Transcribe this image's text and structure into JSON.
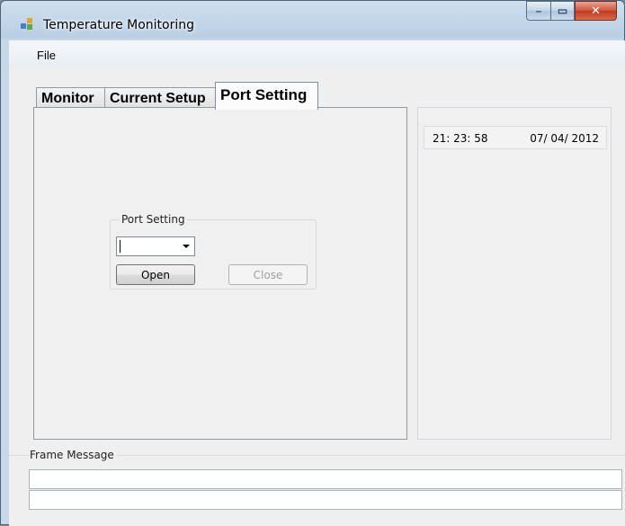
{
  "window": {
    "title": "Temperature Monitoring",
    "caption_min": "–",
    "caption_max": "▭",
    "caption_close": "✕"
  },
  "menu": {
    "items": [
      {
        "label": "File"
      }
    ]
  },
  "tabs": [
    {
      "label": "Monitor",
      "selected": false
    },
    {
      "label": "Current Setup",
      "selected": false
    },
    {
      "label": "Port Setting",
      "selected": true
    }
  ],
  "port_setting": {
    "group_label": "Port Setting",
    "port_combo_value": "",
    "open_label": "Open",
    "close_label": "Close",
    "close_enabled": false
  },
  "clock": {
    "time": "21: 23: 58",
    "date": "07/ 04/ 2012"
  },
  "frame_message": {
    "label": "Frame Message",
    "line1": "",
    "line2": ""
  }
}
